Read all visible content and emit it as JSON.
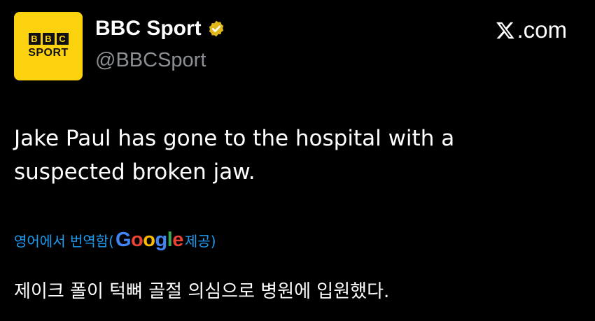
{
  "account": {
    "avatar_top": "BBC",
    "avatar_bottom": "SPORT",
    "display_name": "BBC Sport",
    "handle": "@BBCSport",
    "verified_icon": "gold-verified-badge-icon",
    "avatar_color": "#fcd20f"
  },
  "site": {
    "label": ".com",
    "logo_icon": "x-logo-icon"
  },
  "tweet": {
    "line1": "Jake Paul has gone to the hospital with a",
    "line2": "suspected broken jaw."
  },
  "translation": {
    "prefix": "영어에서 번역함(",
    "google": [
      "G",
      "o",
      "o",
      "g",
      "l",
      "e"
    ],
    "suffix": " 제공)",
    "text": "제이크 폴이 턱뼈 골절 의심으로 병원에 입원했다.",
    "link_color": "#1d9bf0"
  }
}
